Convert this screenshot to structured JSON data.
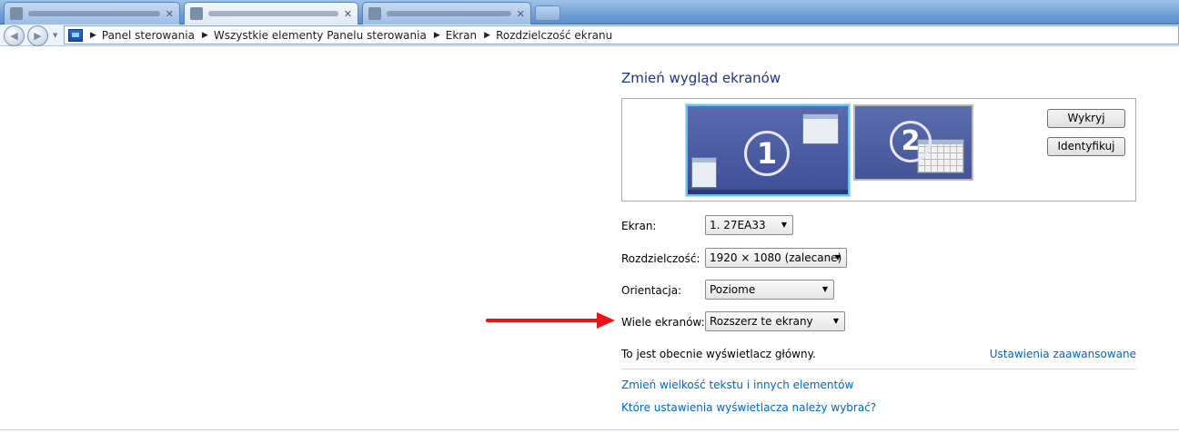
{
  "browser": {
    "tabs": [
      {
        "favicon": "tab-favicon",
        "active": false
      },
      {
        "favicon": "tab-favicon",
        "active": true
      },
      {
        "favicon": "tab-favicon",
        "active": false
      }
    ],
    "close_symbol": "✕"
  },
  "navigation": {
    "back_symbol": "◀",
    "forward_symbol": "▶",
    "dropdown_symbol": "▼",
    "breadcrumb": [
      "Panel sterowania",
      "Wszystkie elementy Panelu sterowania",
      "Ekran",
      "Rozdzielczość ekranu"
    ],
    "breadcrumb_separator": "▶"
  },
  "main": {
    "heading": "Zmień wygląd ekranów",
    "monitors": [
      {
        "number": "1",
        "selected": true
      },
      {
        "number": "2",
        "selected": false
      }
    ],
    "buttons": {
      "detect": "Wykryj",
      "identify": "Identyfikuj"
    },
    "fields": {
      "screen_label": "Ekran:",
      "screen_value": "1. 27EA33",
      "resolution_label": "Rozdzielczość:",
      "resolution_value": "1920 × 1080 (zalecane)",
      "orientation_label": "Orientacja:",
      "orientation_value": "Poziome",
      "multiple_label": "Wiele ekranów:",
      "multiple_value": "Rozszerz te ekrany"
    },
    "select_arrow": "▼",
    "status_text": "To jest obecnie wyświetlacz główny.",
    "advanced_link": "Ustawienia zaawansowane",
    "links": {
      "text_size": "Zmień wielkość tekstu i innych elementów",
      "which_settings": "Które ustawienia wyświetlacza należy wybrać?"
    }
  },
  "colors": {
    "annotation_arrow": "#e8141a",
    "link": "#0066cc",
    "heading": "#1e3287"
  }
}
